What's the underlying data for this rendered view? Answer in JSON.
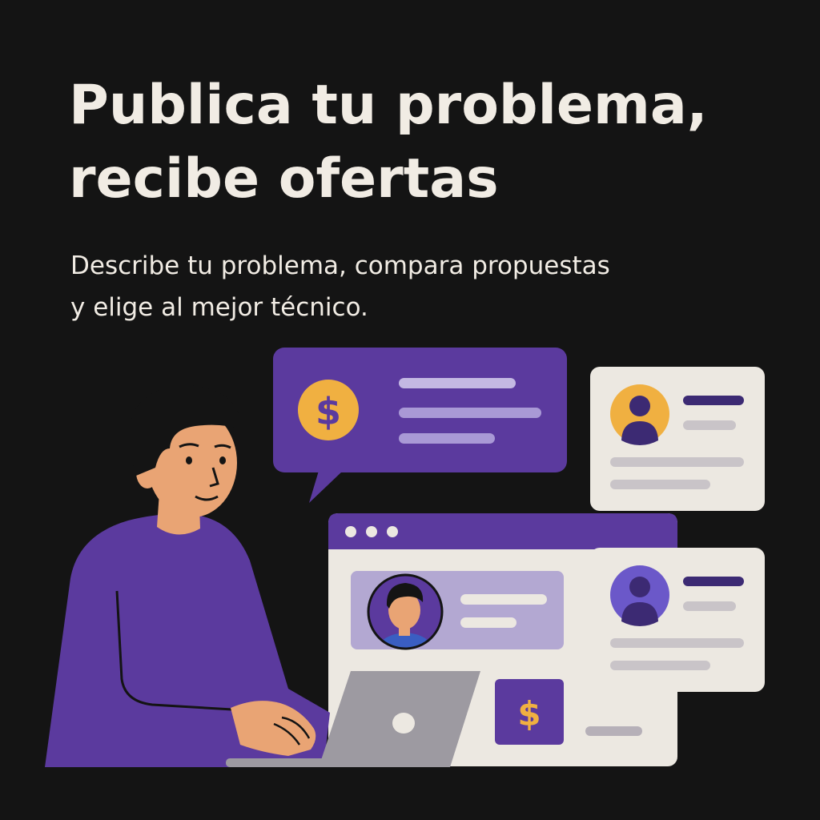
{
  "headline": {
    "line1": "Publica tu problema,",
    "line2": "recibe ofertas"
  },
  "subtitle": {
    "line1": "Describe tu problema, compara propuestas",
    "line2": "y elige al mejor técnico."
  },
  "illustration": {
    "bubble_symbol": "$",
    "button_symbol": "$"
  },
  "colors": {
    "background": "#141414",
    "text": "#f1ece4",
    "purple": "#5b3a9e",
    "gold": "#f0b041",
    "card": "#ece8e1",
    "skin": "#e9a474"
  },
  "icons": [
    "dollar-icon",
    "user-avatar-icon",
    "window-dots-icon",
    "laptop-icon"
  ]
}
